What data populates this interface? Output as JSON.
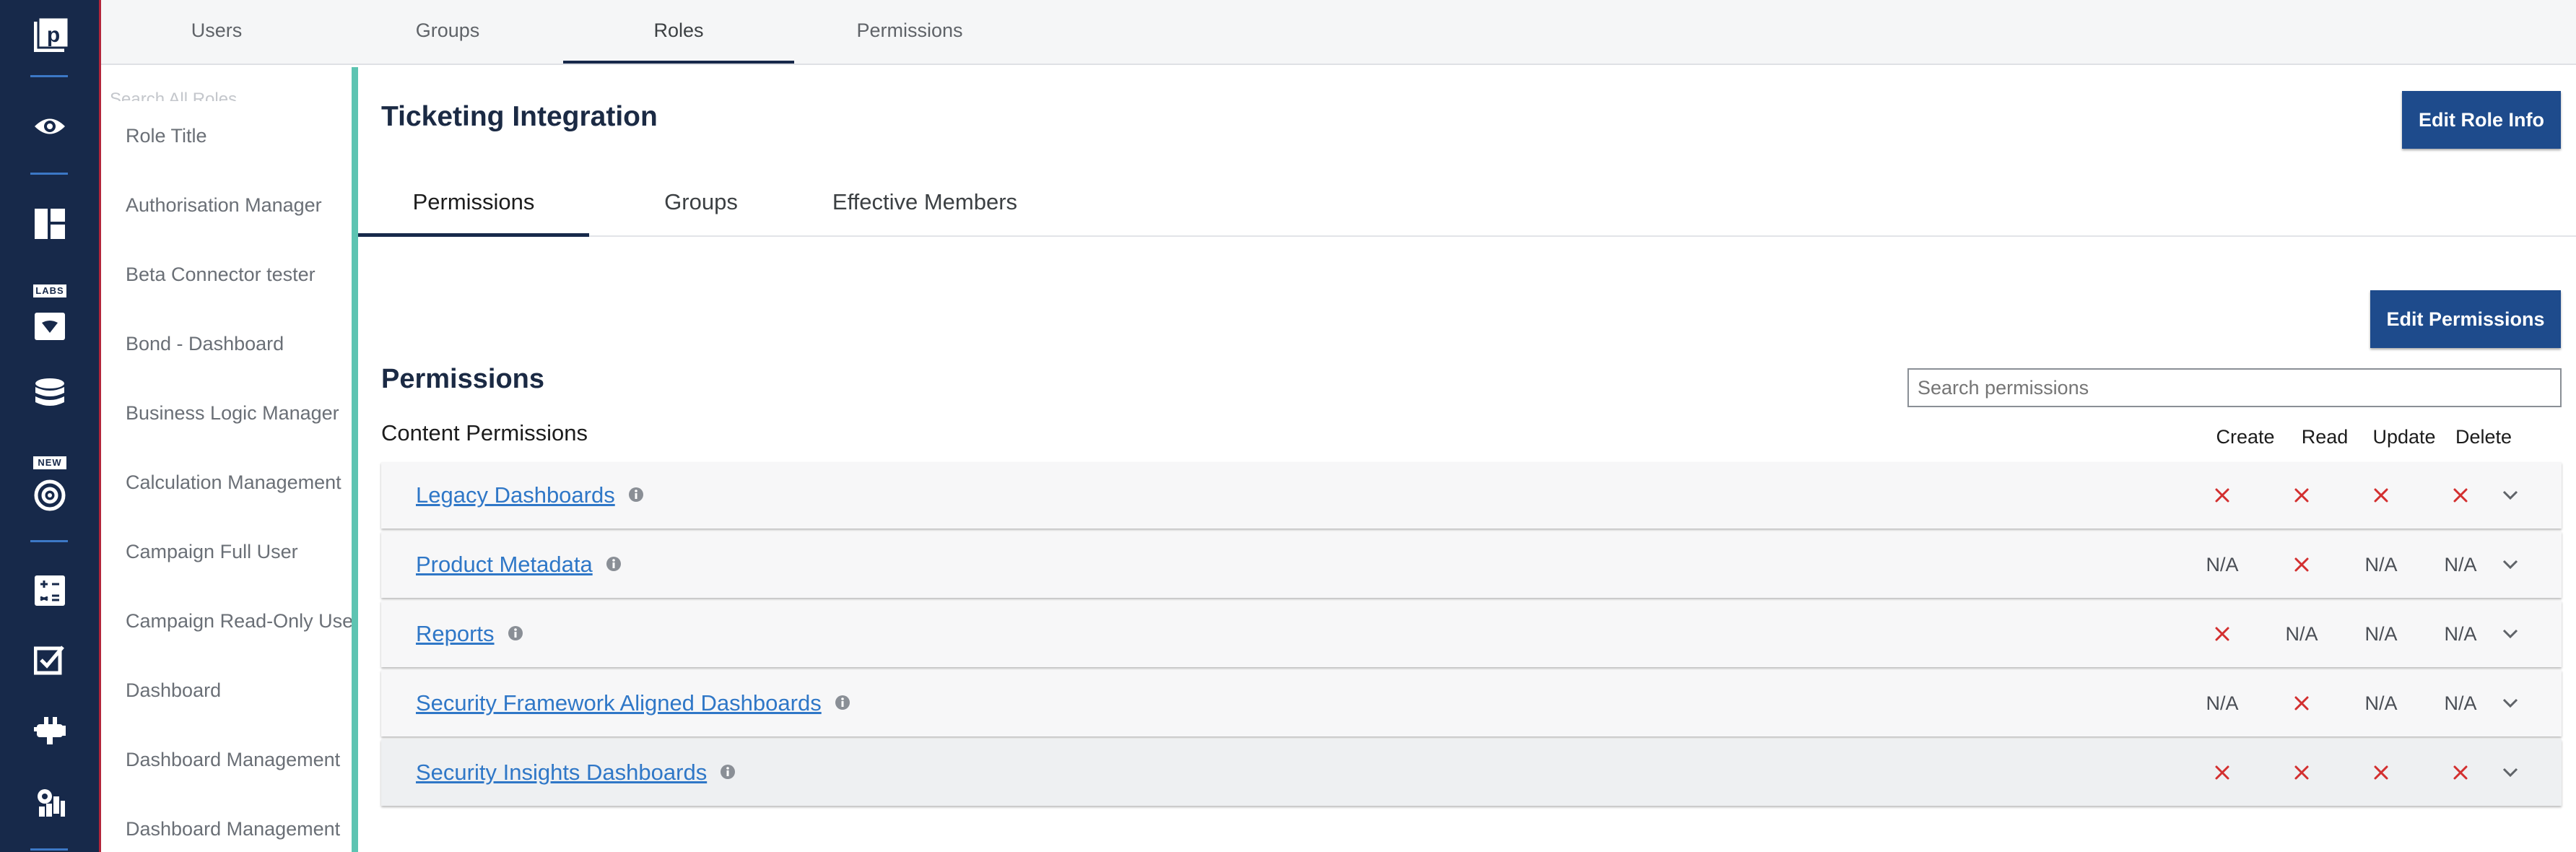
{
  "rail": {
    "icons": [
      "app-logo-icon",
      "eye-icon",
      "dashboard-icon",
      "labs-icon",
      "database-icon",
      "target-icon",
      "calculator-icon",
      "checkbox-edit-icon",
      "plug-icon",
      "settings-icon"
    ],
    "badges": {
      "labs": "LABS",
      "new": "NEW"
    },
    "logo_letter": "p"
  },
  "topnav": {
    "tabs": [
      "Users",
      "Groups",
      "Roles",
      "Permissions"
    ],
    "active": "Roles"
  },
  "rolelist": {
    "search_ghost": "Search All Roles",
    "items": [
      "Role Title",
      "Authorisation Manager",
      "Beta Connector tester",
      "Bond - Dashboard",
      "Business Logic Manager",
      "Calculation Management",
      "Campaign Full User",
      "Campaign Read-Only User",
      "Dashboard",
      "Dashboard Management",
      "Dashboard Management"
    ]
  },
  "main": {
    "role_title": "Ticketing Integration",
    "edit_role_button": "Edit Role Info",
    "subtabs": [
      "Permissions",
      "Groups",
      "Effective Members"
    ],
    "active_subtab": "Permissions",
    "edit_permissions_button": "Edit Permissions",
    "section_title": "Permissions",
    "search_placeholder": "Search permissions",
    "content_label": "Content Permissions",
    "columns": [
      "Create",
      "Read",
      "Update",
      "Delete"
    ],
    "rows": [
      {
        "name": "Legacy Dashboards",
        "create": "x",
        "read": "x",
        "update": "x",
        "delete": "x"
      },
      {
        "name": "Product Metadata",
        "create": "N/A",
        "read": "x",
        "update": "N/A",
        "delete": "N/A"
      },
      {
        "name": "Reports",
        "create": "x",
        "read": "N/A",
        "update": "N/A",
        "delete": "N/A"
      },
      {
        "name": "Security Framework Aligned Dashboards",
        "create": "N/A",
        "read": "x",
        "update": "N/A",
        "delete": "N/A"
      },
      {
        "name": "Security Insights Dashboards",
        "create": "x",
        "read": "x",
        "update": "x",
        "delete": "x"
      }
    ]
  },
  "colors": {
    "rail": "#17294a",
    "accent": "#5dc4b2",
    "primary_button": "#1e4b8c",
    "link": "#2f77c7",
    "deny": "#d32f2f"
  }
}
